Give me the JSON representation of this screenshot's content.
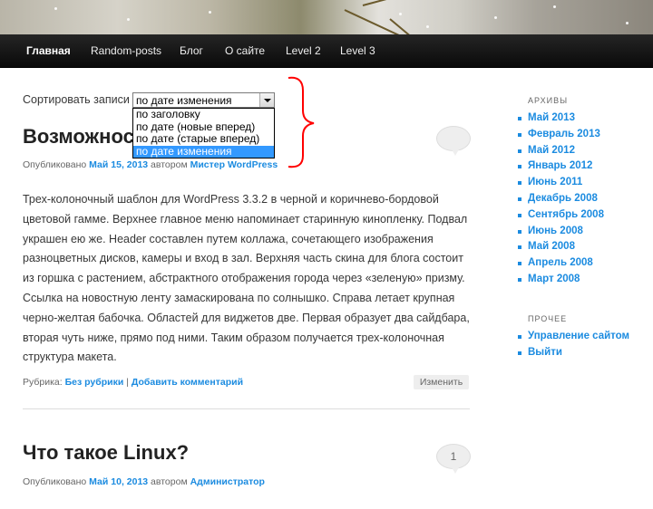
{
  "nav": {
    "items": [
      "Главная",
      "Random-posts",
      "Блог",
      "О сайте",
      "Level 2",
      "Level 3"
    ]
  },
  "sort": {
    "label": "Сортировать записи",
    "selected": "по дате изменения",
    "options": [
      "по заголовку",
      "по дате (новые вперед)",
      "по дате (старые вперед)",
      "по дате изменения"
    ]
  },
  "post1": {
    "title": "Возможнос",
    "meta_prefix": "Опубликовано ",
    "date": "Май 15, 2013",
    "meta_author_prefix": " автором ",
    "author": "Мистер WordPress",
    "paragraph": "Трех-колоночный шаблон для WordPress 3.3.2 в черной и коричнево-бордовой цветовой гамме. Верхнее главное меню напоминает старинную кинопленку. Подвал украшен ею же. Header составлен путем коллажа, сочетающего изображения разноцветных дисков, камеры и вход в зал. Верхняя часть скина для блога состоит из горшка с растением, абстрактного отображения города через «зеленую» призму. Ссылка на новостную ленту замаскирована по солнышко. Справа летает крупная черно-желтая бабочка. Областей для виджетов две. Первая образует два сайдбара, вторая чуть ниже, прямо под ними. Таким образом получается трех-колоночная структура макета.",
    "rubric_label": "Рубрика: ",
    "rubric": "Без рубрики",
    "separator": " | ",
    "add_comment": "Добавить комментарий",
    "edit": "Изменить",
    "comments": ""
  },
  "post2": {
    "title": "Что такое Linux?",
    "meta_prefix": "Опубликовано ",
    "date": "Май 10, 2013",
    "meta_author_prefix": " автором ",
    "author": "Администратор",
    "comments": "1"
  },
  "sidebar": {
    "archives_title": "АРХИВЫ",
    "archives": [
      "Май 2013",
      "Февраль 2013",
      "Май 2012",
      "Январь 2012",
      "Июнь 2011",
      "Декабрь 2008",
      "Сентябрь 2008",
      "Июнь 2008",
      "Май 2008",
      "Апрель 2008",
      "Март 2008"
    ],
    "other_title": "ПРОЧЕЕ",
    "other": [
      "Управление сайтом",
      "Выйти"
    ]
  },
  "colors": {
    "link": "#1b8be0",
    "nav_bg": "#111111",
    "highlight": "#3399ff",
    "annotation": "#ff0000"
  }
}
